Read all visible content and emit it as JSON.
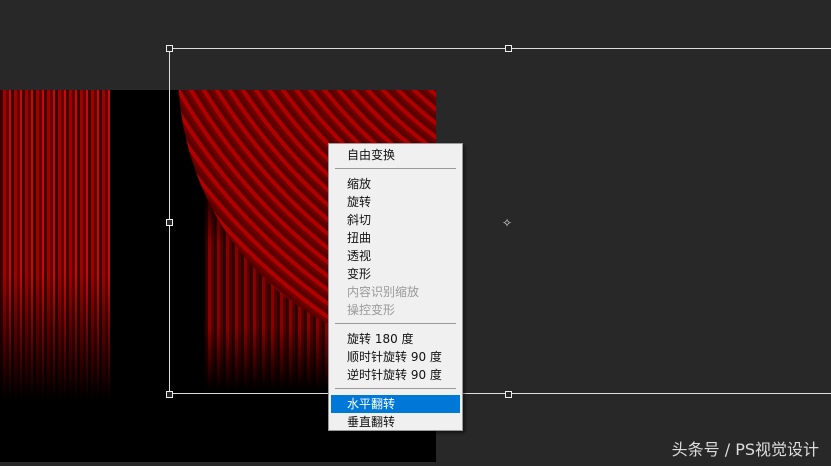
{
  "menu": {
    "groups": [
      [
        {
          "label": "自由变换",
          "enabled": true
        }
      ],
      [
        {
          "label": "缩放",
          "enabled": true
        },
        {
          "label": "旋转",
          "enabled": true
        },
        {
          "label": "斜切",
          "enabled": true
        },
        {
          "label": "扭曲",
          "enabled": true
        },
        {
          "label": "透视",
          "enabled": true
        },
        {
          "label": "变形",
          "enabled": true
        },
        {
          "label": "内容识别缩放",
          "enabled": false
        },
        {
          "label": "操控变形",
          "enabled": false
        }
      ],
      [
        {
          "label": "旋转 180 度",
          "enabled": true
        },
        {
          "label": "顺时针旋转 90 度",
          "enabled": true
        },
        {
          "label": "逆时针旋转 90 度",
          "enabled": true
        }
      ],
      [
        {
          "label": "水平翻转",
          "enabled": true,
          "selected": true
        },
        {
          "label": "垂直翻转",
          "enabled": true
        }
      ]
    ]
  },
  "watermark": "头条号 / PS视觉设计",
  "colors": {
    "accent": "#0078d7",
    "background": "#282828"
  }
}
